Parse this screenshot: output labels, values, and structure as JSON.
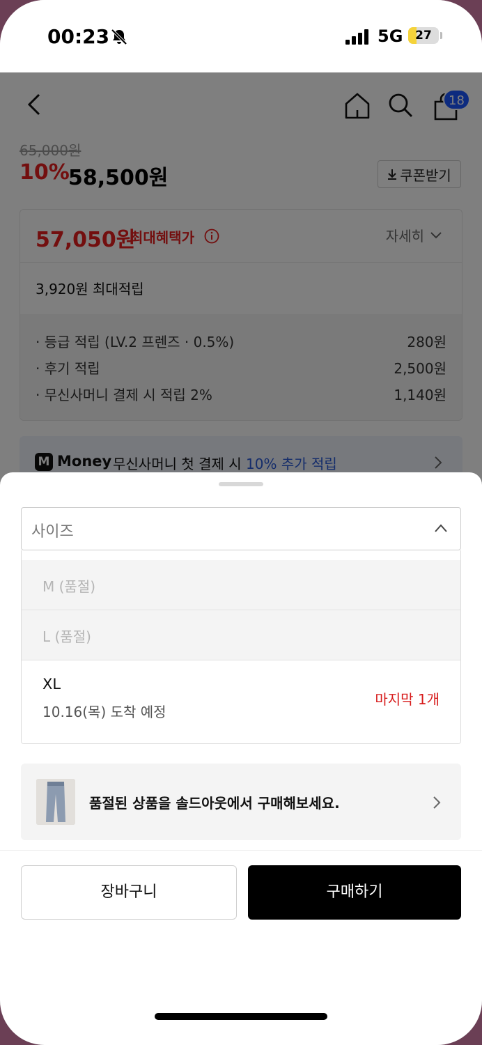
{
  "status_bar": {
    "time": "00:23",
    "network": "5G",
    "battery": "27",
    "battery_level": 0.27
  },
  "nav": {
    "cart_count": "18"
  },
  "product": {
    "original_price": "65,000원",
    "discount_rate": "10%",
    "sale_price": "58,500원",
    "coupon_button": "쿠폰받기"
  },
  "benefit": {
    "max_price": "57,050원",
    "max_label": "최대혜택가",
    "detail_link": "자세히",
    "points_total": "3,920원 최대적립",
    "rows": [
      {
        "label": "· 등급 적립 (LV.2 프렌즈 · 0.5%)",
        "value": "280원"
      },
      {
        "label": "· 후기 적립",
        "value": "2,500원"
      },
      {
        "label": "· 무신사머니 결제 시 적립 2%",
        "value": "1,140원"
      }
    ]
  },
  "money_banner": {
    "icon_letter": "M",
    "brand": "Money",
    "text": "무신사머니 첫 결제 시 ",
    "highlight": "10% 추가 적립"
  },
  "sheet": {
    "size_label": "사이즈",
    "options": [
      {
        "label": "M (품절)"
      },
      {
        "label": "L (품절)"
      }
    ],
    "xl": {
      "name": "XL",
      "eta": "10.16(목) 도착 예정",
      "stock": "마지막 1개"
    },
    "soldout_text": "품절된 상품을 솔드아웃에서 구매해보세요.",
    "cart_button": "장바구니",
    "buy_button": "구매하기"
  },
  "colors": {
    "accent_red": "#e61e1e",
    "badge_blue": "#1a56ff",
    "highlight_blue": "#2a5bd7",
    "buy_black": "#000000"
  }
}
